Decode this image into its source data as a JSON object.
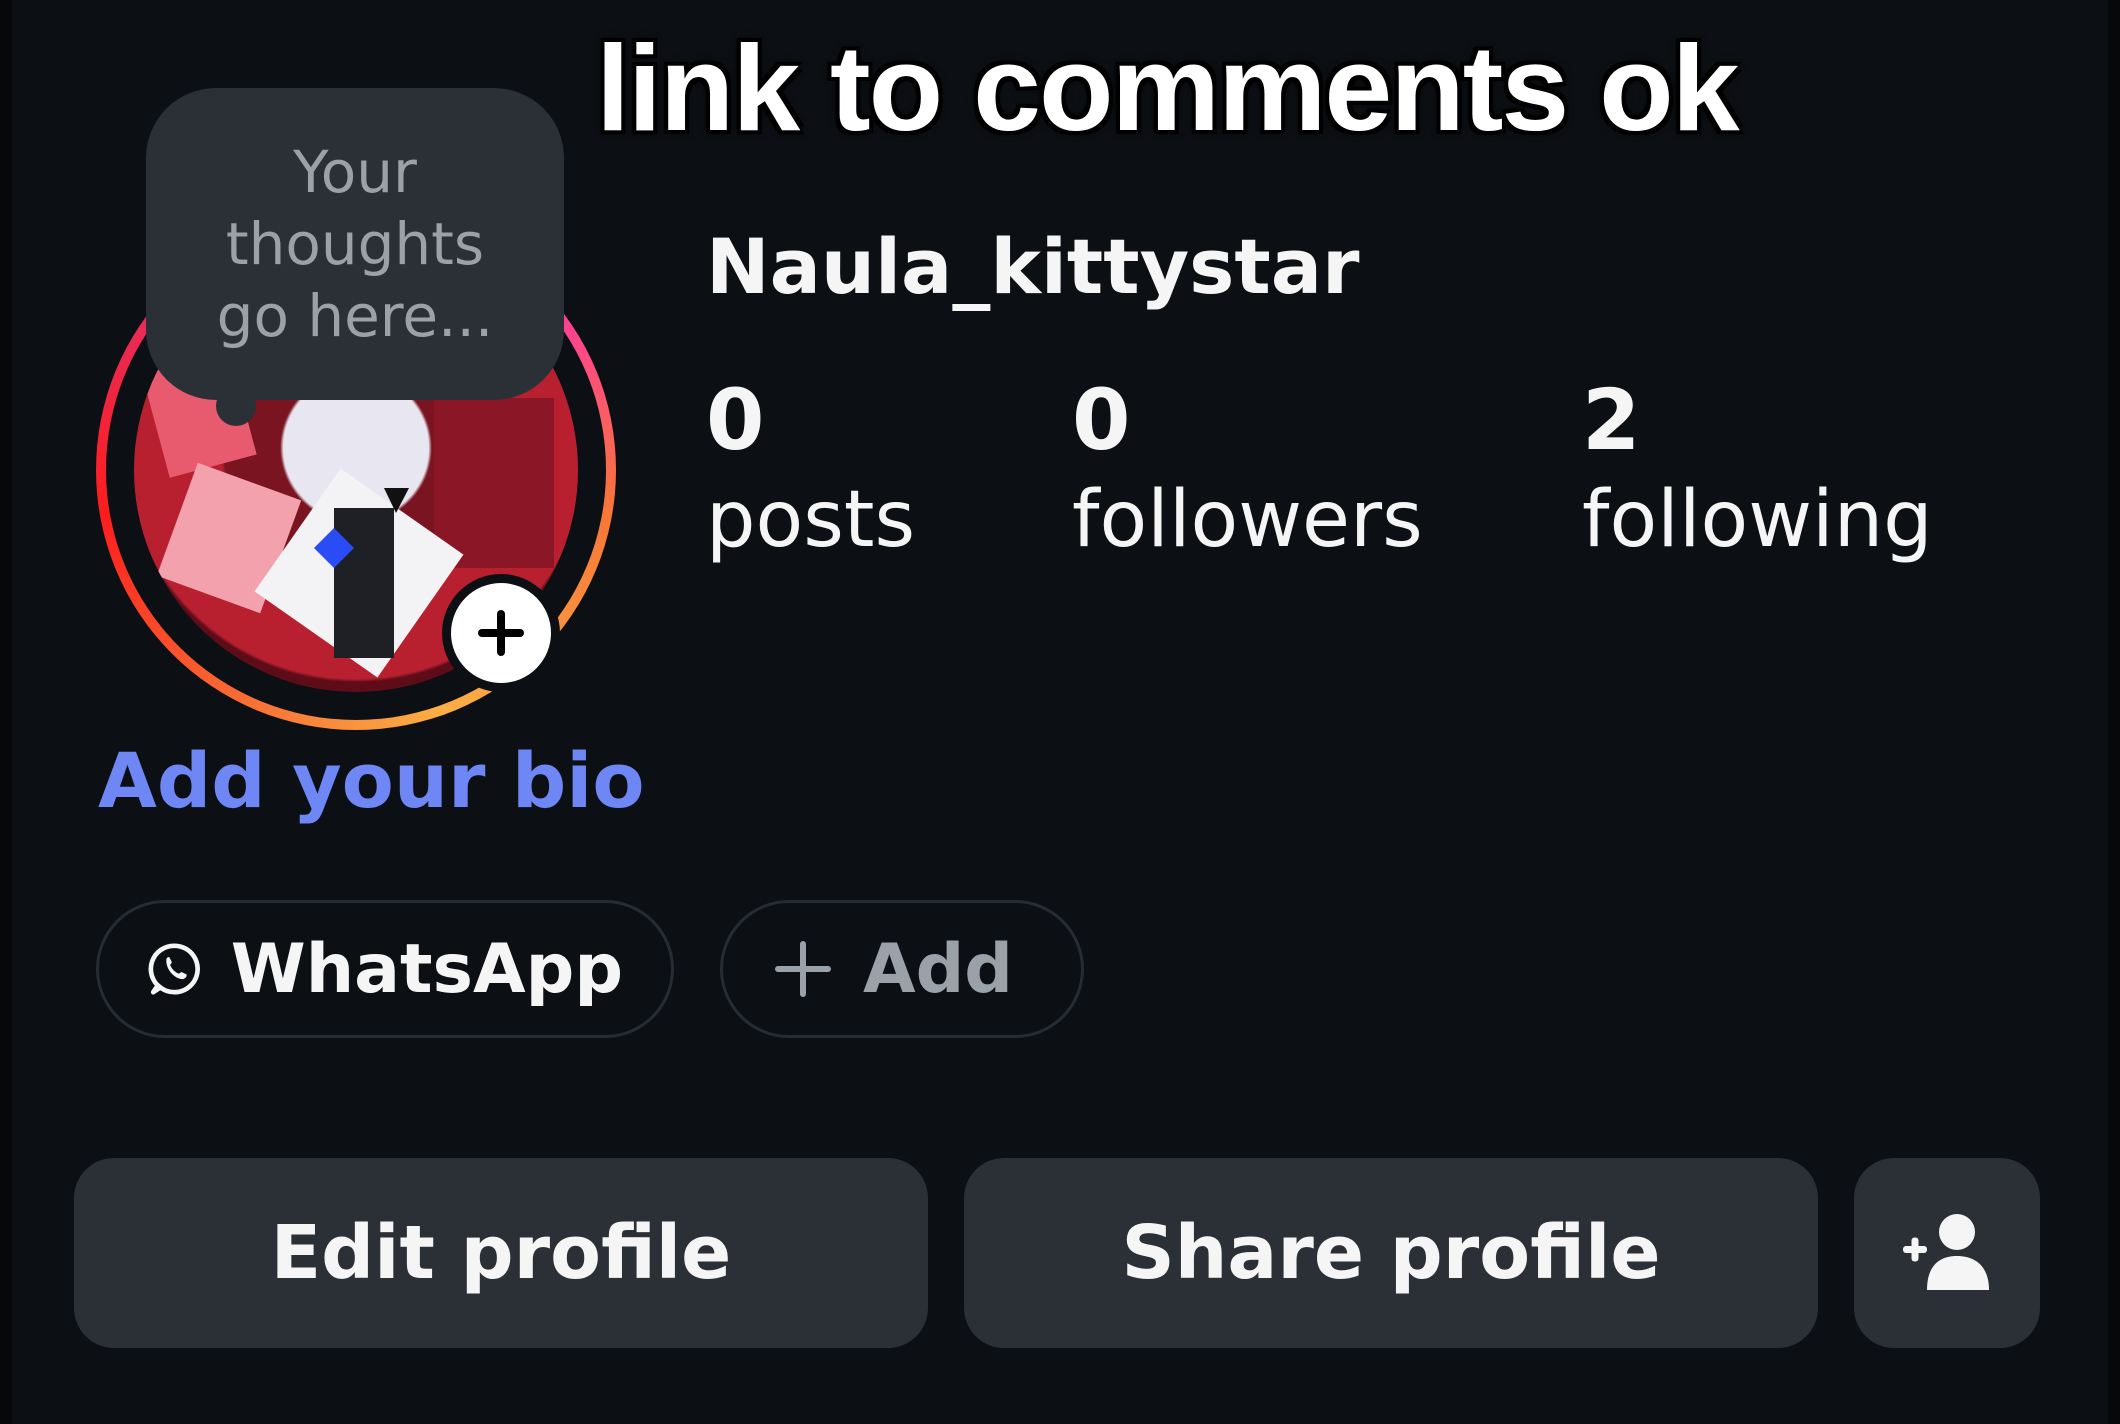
{
  "overlay": {
    "caption": "link to comments ok"
  },
  "profile": {
    "note_placeholder": "Your thoughts go here...",
    "username": "Naula_kittystar",
    "stats": [
      {
        "value": "0",
        "label": "posts"
      },
      {
        "value": "0",
        "label": "followers"
      },
      {
        "value": "2",
        "label": "following"
      }
    ],
    "add_bio": "Add your bio",
    "links": [
      {
        "label": "WhatsApp",
        "icon": "whatsapp-icon"
      },
      {
        "label": "Add",
        "icon": "plus-icon"
      }
    ],
    "actions": {
      "edit": "Edit profile",
      "share": "Share profile",
      "discover_icon": "add-person-icon"
    }
  },
  "colors": {
    "background": "#0c1014",
    "button": "#2a3036",
    "bio_link": "#6e87f5",
    "text": "#f5f5f5",
    "muted": "#9aa1a8"
  }
}
